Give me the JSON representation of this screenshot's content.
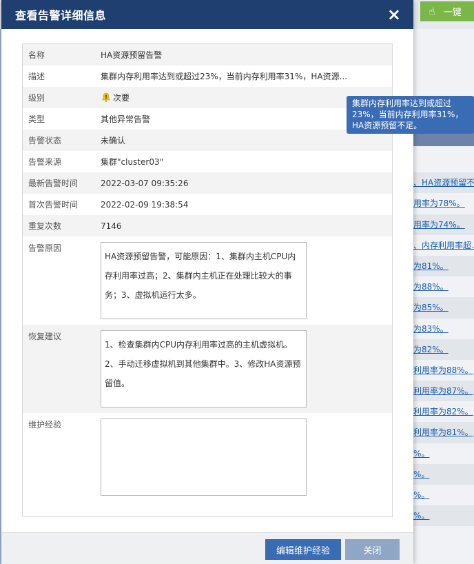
{
  "background": {
    "onekey_label": "一键",
    "rows": [
      "",
      "、HA资源预留不...",
      "用率为78%。",
      "用率为74%。",
      "、内存利用率超...",
      "为81%。",
      "为88%。",
      "为85%。",
      "为83%。",
      "为82%。",
      "利用率为88%。",
      "利用率为87%。",
      "利用率为82%。",
      "利用率为81%。",
      "%。",
      "%。",
      "%。",
      "%。"
    ]
  },
  "dialog": {
    "title": "查看告警详细信息",
    "close": "×",
    "fields": {
      "name_label": "名称",
      "name_value": "HA资源预留告警",
      "desc_label": "描述",
      "desc_value": "集群内存利用率达到或超过23%，当前内存利用率31%，HA资源...",
      "level_label": "级别",
      "level_value": "次要",
      "type_label": "类型",
      "type_value": "其他异常告警",
      "status_label": "告警状态",
      "status_value": "未确认",
      "source_label": "告警来源",
      "source_value": "集群\"cluster03\"",
      "latest_label": "最新告警时间",
      "latest_value": "2022-03-07 09:35:26",
      "first_label": "首次告警时间",
      "first_value": "2022-02-09 19:38:54",
      "repeat_label": "重复次数",
      "repeat_value": "7146",
      "cause_label": "告警原因",
      "cause_value": "HA资源预留告警，可能原因：1、集群内主机CPU内存利用率过高；2、集群内主机正在处理比较大的事务；3、虚拟机运行太多。",
      "advice_label": "恢复建议",
      "advice_value": "1、检查集群内CPU内存利用率过高的主机虚拟机。2、手动迁移虚拟机到其他集群中。3、修改HA资源预留值。",
      "exp_label": "维护经验",
      "exp_value": ""
    },
    "buttons": {
      "edit": "编辑维护经验",
      "close": "关闭"
    }
  },
  "tooltip": "集群内存利用率达到或超过23%，当前内存利用率31%，HA资源预留不足。",
  "colors": {
    "header": "#1f3f70",
    "primary": "#3a6bb5",
    "secondary": "#8fa6c7",
    "warning": "#f5c400",
    "onekey": "#7ab648"
  }
}
